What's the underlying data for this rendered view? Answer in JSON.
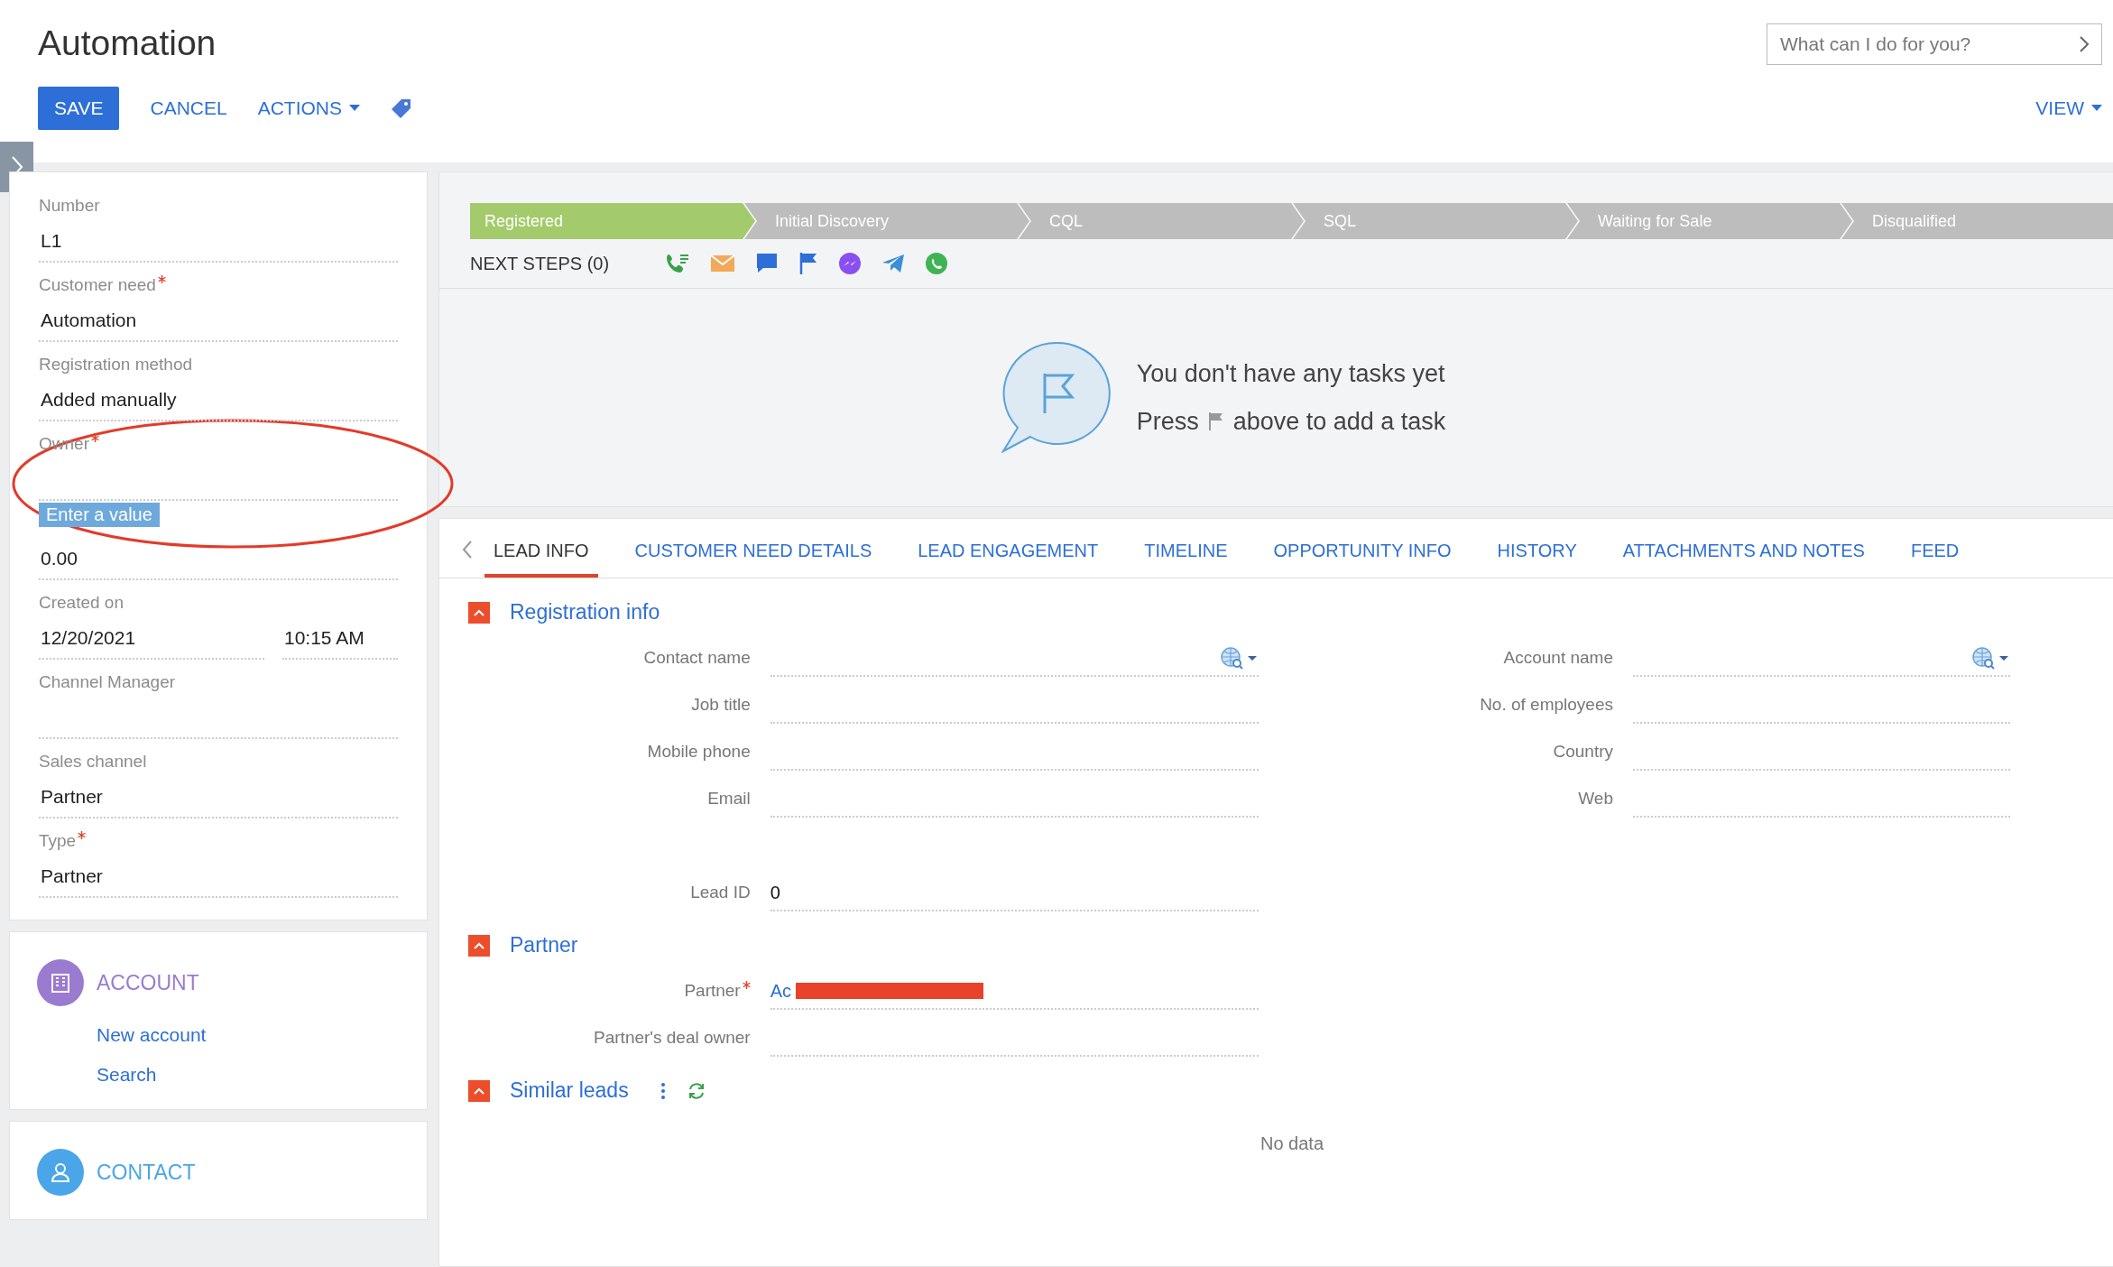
{
  "header": {
    "title": "Automation",
    "buttons": [
      {
        "label": "SAVE",
        "kind": "primary"
      },
      {
        "label": "CANCEL",
        "kind": "link"
      },
      {
        "label": "ACTIONS",
        "kind": "menu"
      }
    ],
    "search": {
      "placeholder": "What can I do for you?"
    },
    "view": "VIEW"
  },
  "left_fields": [
    {
      "label": "Number",
      "value": "L1",
      "required": false
    },
    {
      "label": "Customer need",
      "value": "Automation",
      "required": true
    },
    {
      "label": "Registration method",
      "value": "Added manually",
      "required": false
    },
    {
      "label": "Owner",
      "required": true,
      "hint": "Enter a value"
    },
    {
      "value": "0.00"
    },
    {
      "label": "Created on",
      "kind": "datetime",
      "date": "12/20/2021",
      "time": "10:15 AM",
      "required": false
    },
    {
      "label": "Channel Manager",
      "required": false
    },
    {
      "label": "Sales channel",
      "value": "Partner",
      "required": false
    },
    {
      "label": "Type",
      "value": "Partner",
      "required": true
    }
  ],
  "modules": [
    {
      "title": "ACCOUNT",
      "kind": "building",
      "color": "#9a7bd0",
      "links": [
        "New account",
        "Search"
      ]
    },
    {
      "title": "CONTACT",
      "kind": "person",
      "color": "#4aa6e8"
    }
  ],
  "stages": [
    {
      "label": "Registered",
      "selected": true
    },
    {
      "label": "Initial Discovery",
      "selected": false
    },
    {
      "label": "CQL",
      "selected": false
    },
    {
      "label": "SQL",
      "selected": false
    },
    {
      "label": "Waiting for Sale",
      "selected": false
    },
    {
      "label": "Disqualified",
      "selected": false
    }
  ],
  "next_steps": {
    "label": "NEXT STEPS (0)",
    "actions": [
      {
        "kind": "call"
      },
      {
        "kind": "email"
      },
      {
        "kind": "chat"
      },
      {
        "kind": "flag"
      },
      {
        "kind": "messenger"
      },
      {
        "kind": "telegram"
      },
      {
        "kind": "whatsapp"
      }
    ]
  },
  "empty_tasks": {
    "title": "You don't have any tasks yet",
    "hint_before": "Press",
    "hint_after": "above to add a task"
  },
  "tabs": [
    {
      "label": "LEAD INFO",
      "selected": true
    },
    {
      "label": "CUSTOMER NEED DETAILS",
      "selected": false
    },
    {
      "label": "LEAD ENGAGEMENT",
      "selected": false
    },
    {
      "label": "TIMELINE",
      "selected": false
    },
    {
      "label": "OPPORTUNITY INFO",
      "selected": false
    },
    {
      "label": "HISTORY",
      "selected": false
    },
    {
      "label": "ATTACHMENTS AND NOTES",
      "selected": false
    },
    {
      "label": "FEED",
      "selected": false
    }
  ],
  "sections": [
    {
      "title": "Registration info",
      "expanded": true,
      "columns": [
        [
          {
            "label": "Contact name",
            "kind": "lookup"
          },
          {
            "label": "Job title"
          },
          {
            "label": "Mobile phone"
          },
          {
            "label": "Email"
          },
          {
            "label": "Lead ID",
            "value": "0",
            "kind": "spaced"
          }
        ],
        [
          {
            "label": "Account name",
            "kind": "lookup"
          },
          {
            "label": "No. of employees"
          },
          {
            "label": "Country"
          },
          {
            "label": "Web"
          }
        ]
      ]
    },
    {
      "title": "Partner",
      "expanded": true,
      "columns": [
        [
          {
            "label": "Partner",
            "required": true,
            "value": "Ac",
            "kind": "link"
          },
          {
            "label": "Partner's deal owner"
          }
        ]
      ]
    },
    {
      "title": "Similar leads",
      "expanded": true,
      "tools": true,
      "empty": "No data"
    }
  ]
}
